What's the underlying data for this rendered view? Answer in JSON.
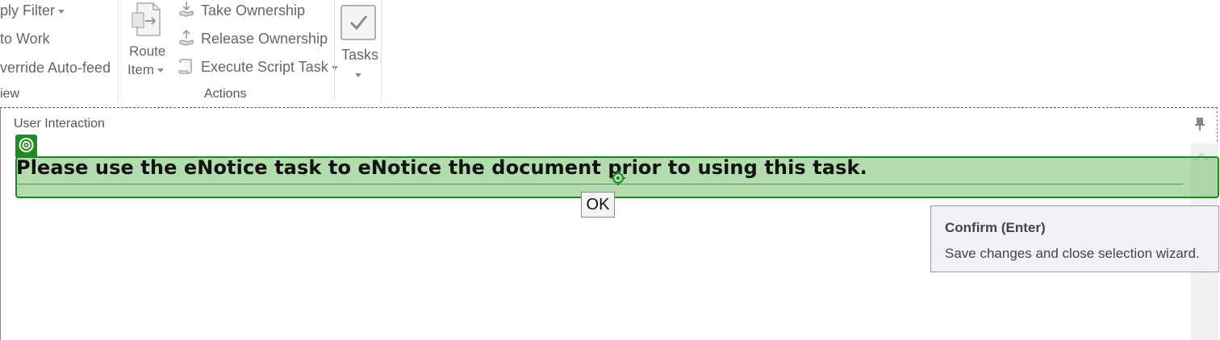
{
  "ribbon": {
    "view_group": {
      "apply_filter_label": "ply Filter",
      "to_work_label": "to Work",
      "override_autofeed_label": "verride Auto-feed",
      "group_label": "iew"
    },
    "actions_group": {
      "route_item_line1": "Route",
      "route_item_line2": "Item",
      "take_ownership_label": "Take Ownership",
      "release_ownership_label": "Release Ownership",
      "execute_script_task_label": "Execute Script Task",
      "group_label": "Actions"
    },
    "tasks_group": {
      "tasks_label": "Tasks"
    }
  },
  "panel": {
    "title": "User Interaction",
    "message": "Please use the eNotice task to eNotice the document prior to using this task.",
    "ok_label": "OK"
  },
  "tooltip": {
    "title": "Confirm (Enter)",
    "body": "Save changes and close selection wizard."
  },
  "colors": {
    "highlight_fill": "#7ec478",
    "highlight_border": "#1a8c1a",
    "tooltip_bg": "#f1f2f7"
  }
}
